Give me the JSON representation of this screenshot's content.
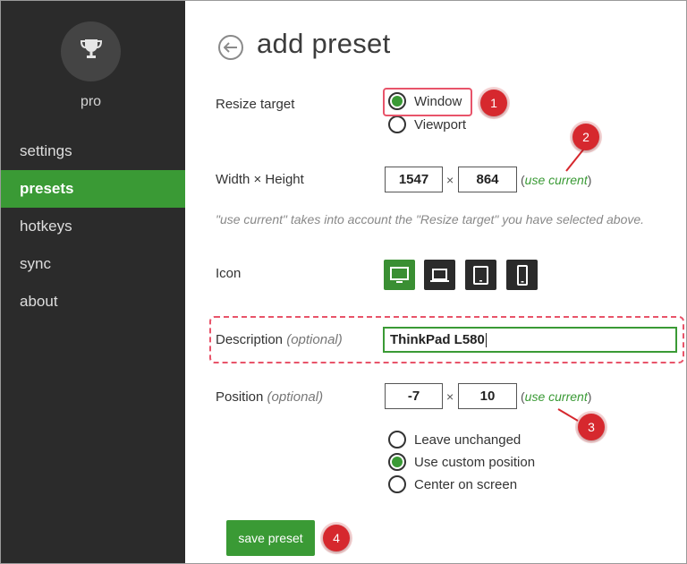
{
  "sidebar": {
    "profile_label": "pro",
    "items": [
      {
        "label": "settings",
        "active": false
      },
      {
        "label": "presets",
        "active": true
      },
      {
        "label": "hotkeys",
        "active": false
      },
      {
        "label": "sync",
        "active": false
      },
      {
        "label": "about",
        "active": false
      }
    ]
  },
  "main": {
    "title": "add preset",
    "resize_target": {
      "label": "Resize target",
      "options": [
        "Window",
        "Viewport"
      ],
      "selected": "Window"
    },
    "size": {
      "label": "Width × Height",
      "width": "1547",
      "height": "864",
      "separator": "×",
      "use_current": "use current",
      "hint": "\"use current\" takes into account the \"Resize target\" you have selected above."
    },
    "icon": {
      "label": "Icon",
      "options": [
        "desktop-icon",
        "laptop-icon",
        "tablet-icon",
        "phone-icon"
      ],
      "selected": "desktop-icon"
    },
    "description": {
      "label": "Description",
      "optional": "(optional)",
      "value": "ThinkPad L580"
    },
    "position": {
      "label": "Position",
      "optional": "(optional)",
      "x": "-7",
      "y": "10",
      "separator": "×",
      "use_current": "use current",
      "options": [
        "Leave unchanged",
        "Use custom position",
        "Center on screen"
      ],
      "selected": "Use custom position"
    },
    "save_label": "save preset"
  },
  "annotations": {
    "badges": [
      "1",
      "2",
      "3",
      "4"
    ],
    "color": "#d6282e"
  },
  "colors": {
    "accent": "#3a9a35",
    "sidebar_bg": "#2b2b2b"
  }
}
